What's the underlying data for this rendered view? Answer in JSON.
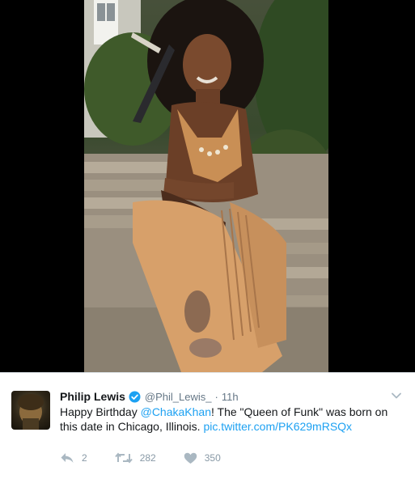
{
  "tweet": {
    "author_name": "Philip Lewis",
    "handle": "@Phil_Lewis_",
    "separator": "·",
    "time": "11h",
    "text_before": "Happy Birthday ",
    "mention": "@ChakaKhan",
    "text_after": "! The  \"Queen of Funk\" was born on this date in Chicago, Illinois. ",
    "pic_link": "pic.twitter.com/PK629mRSQx",
    "reply_count": "2",
    "retweet_count": "282",
    "like_count": "350"
  },
  "colors": {
    "link": "#1da1f2",
    "verified_badge": "#1da1f2",
    "muted_text": "#657786",
    "action_icon": "#aab8c2",
    "media_background": "#000000"
  },
  "icons": {
    "verified": "verified-badge-icon",
    "caret": "chevron-down-icon",
    "reply": "reply-icon",
    "retweet": "retweet-icon",
    "like": "heart-icon"
  }
}
